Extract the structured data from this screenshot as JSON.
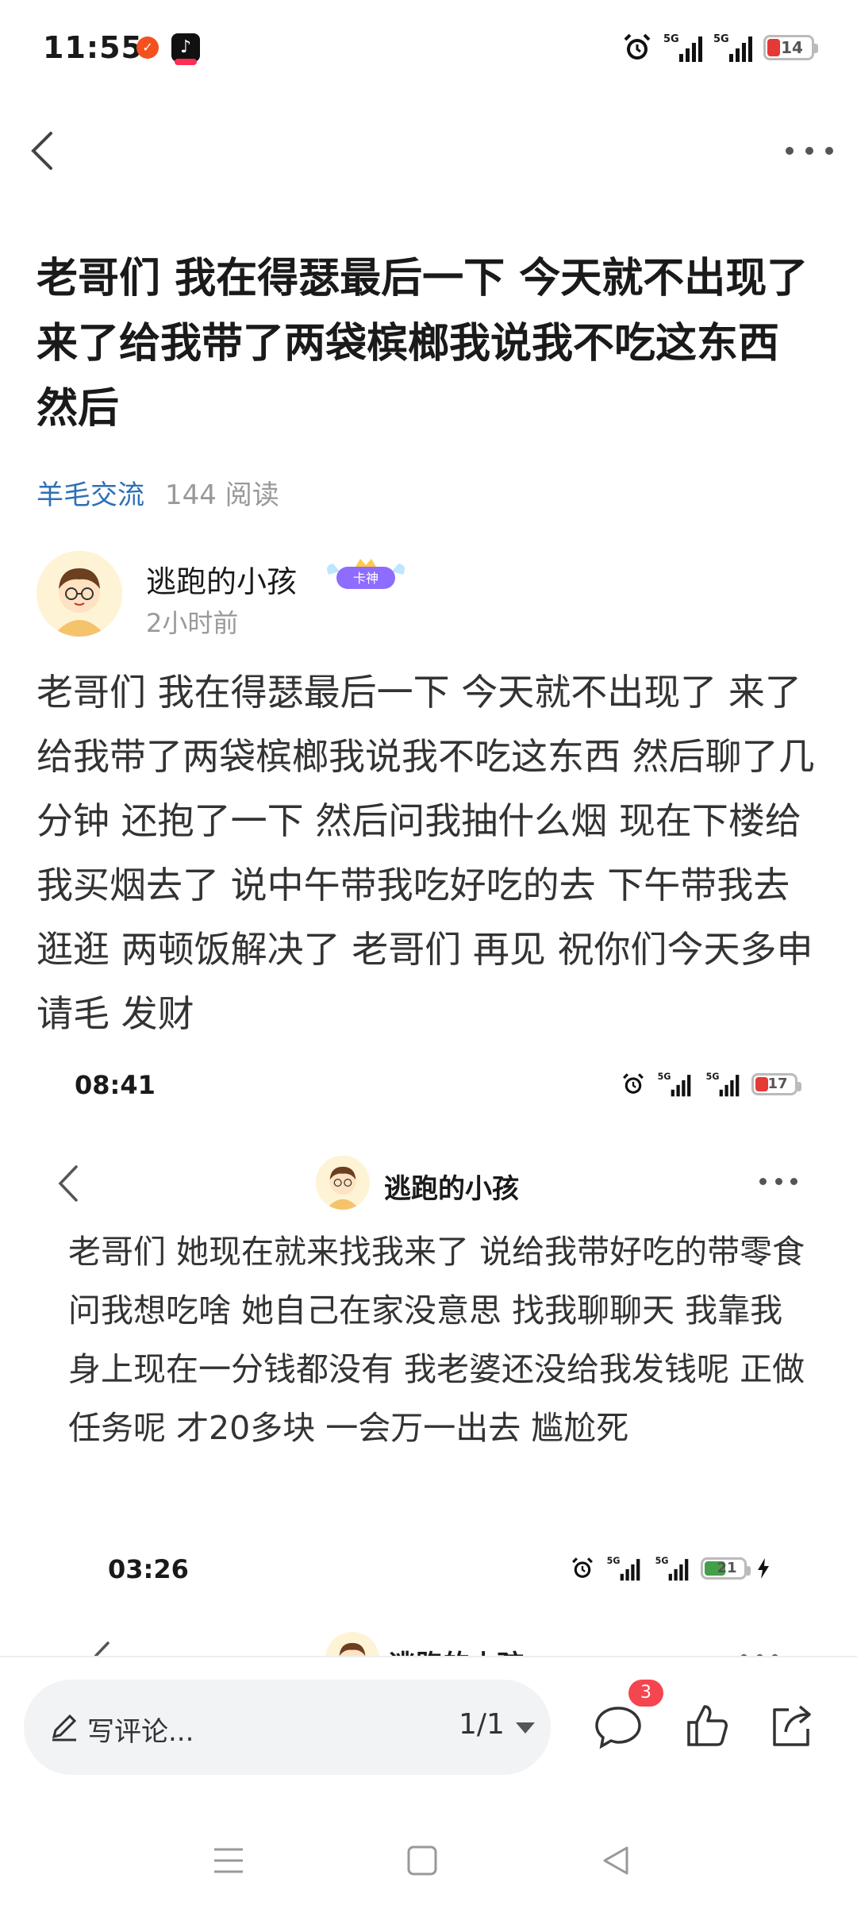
{
  "status_bar": {
    "time": "11:55",
    "signal1_label": "5G",
    "signal2_label": "5G",
    "battery": "14"
  },
  "post": {
    "title": "老哥们 我在得瑟最后一下 今天就不出现了 来了给我带了两袋槟榔我说我不吃这东西 然后",
    "tag": "羊毛交流",
    "reads": "144 阅读",
    "author_name": "逃跑的小孩",
    "badge_label": "卡神",
    "time_ago": "2小时前",
    "body": "老哥们 我在得瑟最后一下 今天就不出现了 来了给我带了两袋槟榔我说我不吃这东西 然后聊了几分钟 还抱了一下 然后问我抽什么烟 现在下楼给我买烟去了 说中午带我吃好吃的去 下午带我去逛逛 两顿饭解决了 老哥们 再见 祝你们今天多申请毛 发财"
  },
  "screenshot1": {
    "time": "08:41",
    "battery": "17",
    "author_name": "逃跑的小孩",
    "text": "老哥们 她现在就来找我来了 说给我带好吃的带零食 问我想吃啥 她自己在家没意思 找我聊聊天 我靠我身上现在一分钱都没有 我老婆还没给我发钱呢 正做任务呢 才20多块 一会万一出去 尴尬死"
  },
  "screenshot2": {
    "time": "03:26",
    "battery": "21",
    "author_name": "逃跑的小孩"
  },
  "bottom_bar": {
    "comment_placeholder": "写评论...",
    "pager": "1/1",
    "comment_count": "3"
  }
}
